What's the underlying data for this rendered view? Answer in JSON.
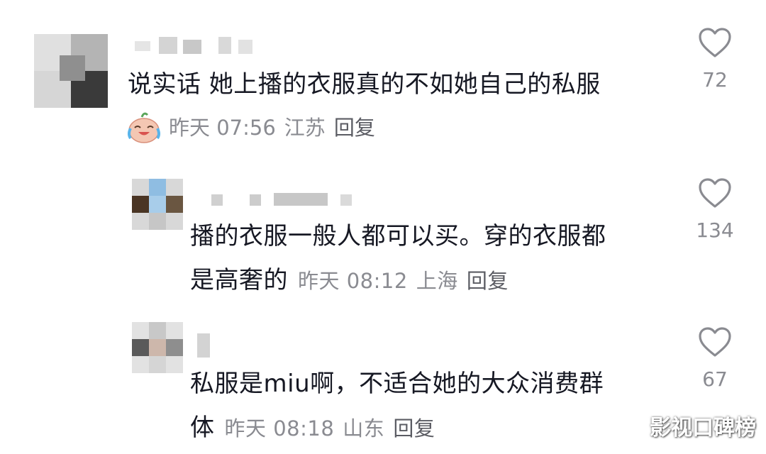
{
  "comments": [
    {
      "text": "说实话 她上播的衣服真的不如她自己的私服",
      "time": "昨天 07:56",
      "location": "江苏",
      "reply_label": "回复",
      "likes": "72",
      "has_emoji_badge": true
    },
    {
      "text_line1": "播的衣服一般人都可以买。穿的衣服都",
      "text_line2": "是高奢的",
      "time": "昨天 08:12",
      "location": "上海",
      "reply_label": "回复",
      "likes": "134"
    },
    {
      "text_line1": "私服是miu啊，不适合她的大众消费群",
      "text_line2": "体",
      "time": "昨天 08:18",
      "location": "山东",
      "reply_label": "回复",
      "likes": "67"
    }
  ],
  "icons": {
    "like": "heart-outline-icon",
    "badge": "crying-laughing-emoji-icon"
  },
  "watermark": "影视口碑榜"
}
